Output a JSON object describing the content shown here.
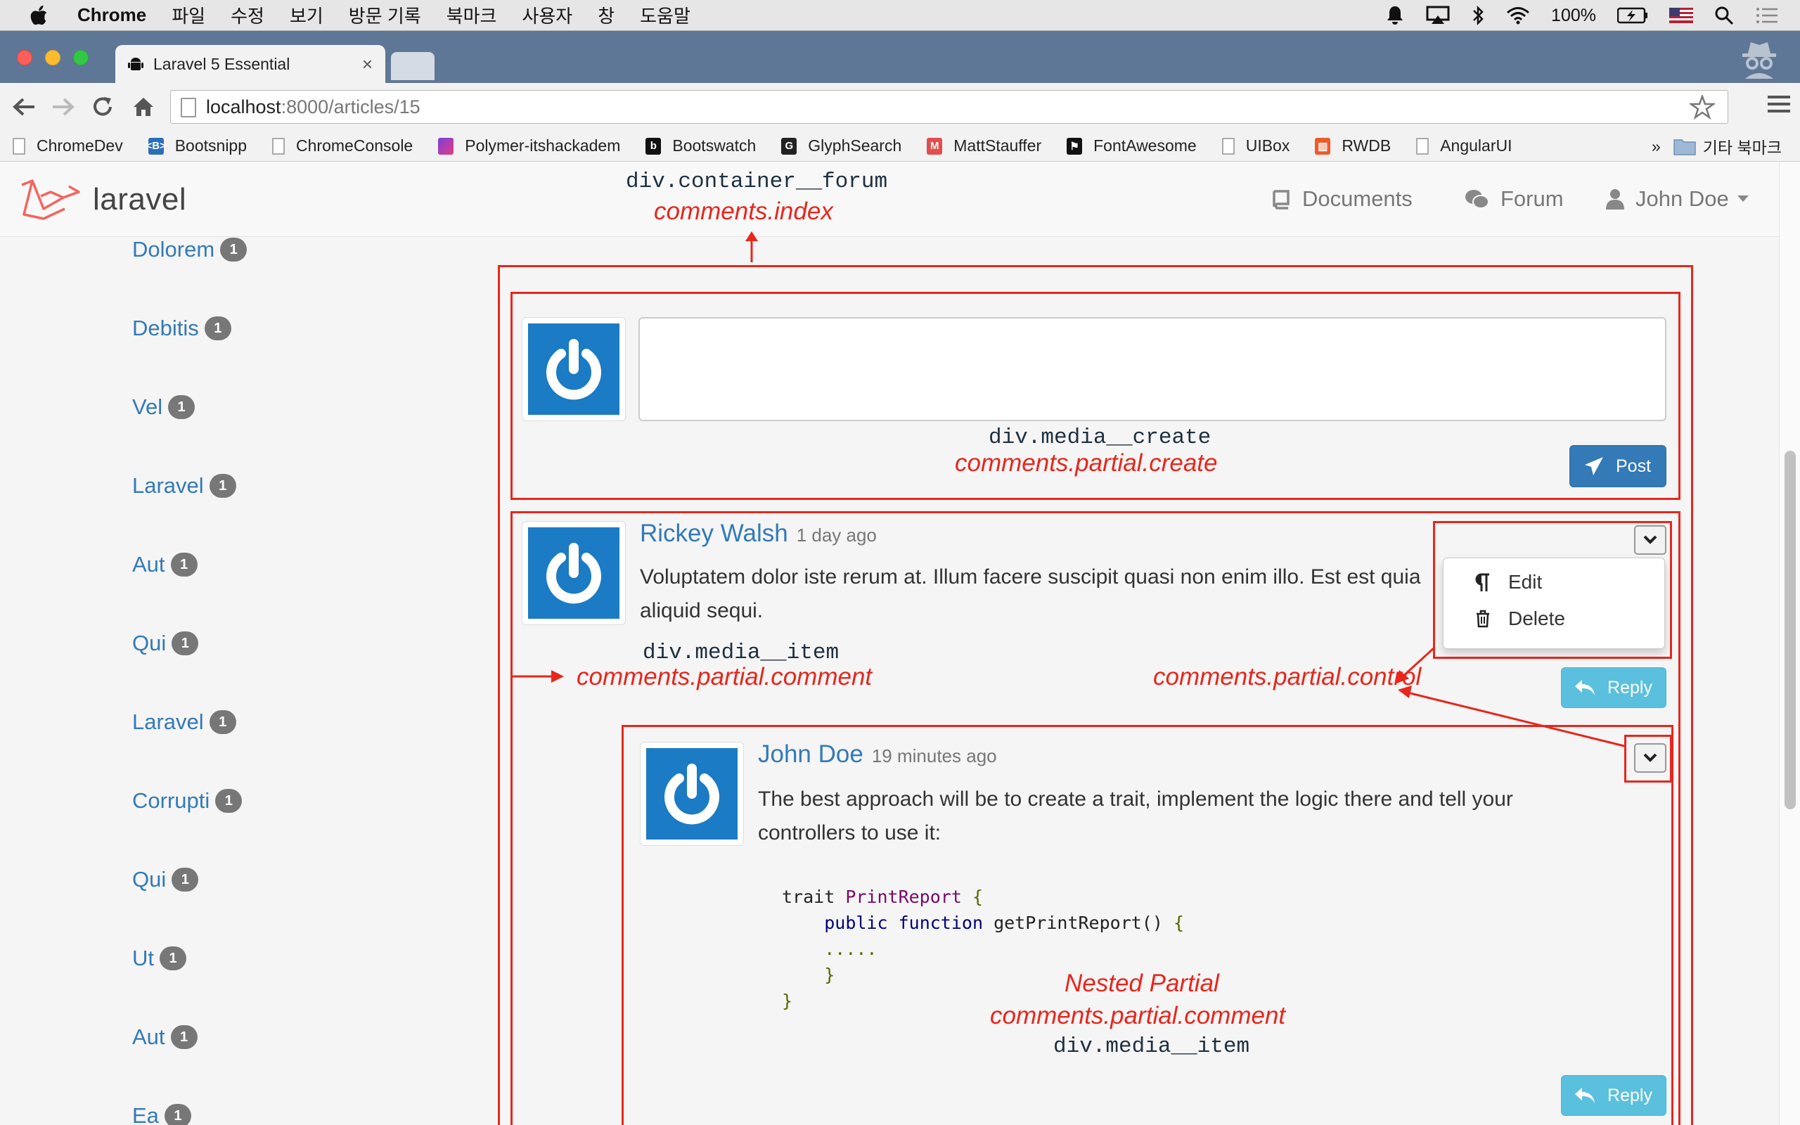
{
  "menubar": {
    "app_name": "Chrome",
    "items": [
      "파일",
      "수정",
      "보기",
      "방문 기록",
      "북마크",
      "사용자",
      "창",
      "도움말"
    ],
    "battery": "100%"
  },
  "browser": {
    "tab_title": "Laravel 5 Essential",
    "url_host": "localhost",
    "url_path": ":8000/articles/15",
    "bookmarks": [
      "ChromeDev",
      "Bootsnipp",
      "ChromeConsole",
      "Polymer-itshackadem",
      "Bootswatch",
      "GlyphSearch",
      "MattStauffer",
      "FontAwesome",
      "UIBox",
      "RWDB",
      "AngularUI"
    ],
    "bookmarks_overflow": "»",
    "other_bookmarks": "기타 북마크"
  },
  "navbar": {
    "brand": "laravel",
    "documents": "Documents",
    "forum": "Forum",
    "user": "John Doe"
  },
  "sidebar": {
    "tags": [
      {
        "name": "Dolorem",
        "count": "1"
      },
      {
        "name": "Debitis",
        "count": "1"
      },
      {
        "name": "Vel",
        "count": "1"
      },
      {
        "name": "Laravel",
        "count": "1"
      },
      {
        "name": "Aut",
        "count": "1"
      },
      {
        "name": "Qui",
        "count": "1"
      },
      {
        "name": "Laravel",
        "count": "1"
      },
      {
        "name": "Corrupti",
        "count": "1"
      },
      {
        "name": "Qui",
        "count": "1"
      },
      {
        "name": "Ut",
        "count": "1"
      },
      {
        "name": "Aut",
        "count": "1"
      },
      {
        "name": "Ea",
        "count": "1"
      }
    ]
  },
  "annotations": {
    "container_code": "div.container__forum",
    "container_view": "comments.index",
    "create_code": "div.media__create",
    "create_view": "comments.partial.create",
    "item_code": "div.media__item",
    "comment_view": "comments.partial.comment",
    "control_view": "comments.partial.control",
    "nested_title": "Nested Partial",
    "nested_view": "comments.partial.comment",
    "nested_code": "div.media__item"
  },
  "create_form": {
    "post_label": "Post"
  },
  "comments": [
    {
      "author": "Rickey Walsh",
      "time": "1 day ago",
      "body": "Voluptatem dolor iste rerum at. Illum facere suscipit quasi non enim illo. Est est quia aliquid sequi.",
      "reply_label": "Reply",
      "menu": {
        "edit": "Edit",
        "delete": "Delete"
      }
    },
    {
      "author": "John Doe",
      "time": "19 minutes ago",
      "body": "The best approach will be to create a trait, implement the logic there and tell your controllers to use it:",
      "reply_label": "Reply",
      "code": {
        "l1_kw": "trait",
        "l1_name": "PrintReport",
        "l1_brace": "{",
        "l2_kw1": "public",
        "l2_kw2": "function",
        "l2_name": "getPrintReport()",
        "l2_brace": "{",
        "l3": ".....",
        "l4": "}",
        "l5": "}"
      }
    }
  ],
  "colors": {
    "annotation_red": "#e8261c",
    "link_blue": "#337ab7",
    "primary": "#337ab7",
    "info": "#5bc0de",
    "avatar_blue": "#1b7bc4"
  }
}
